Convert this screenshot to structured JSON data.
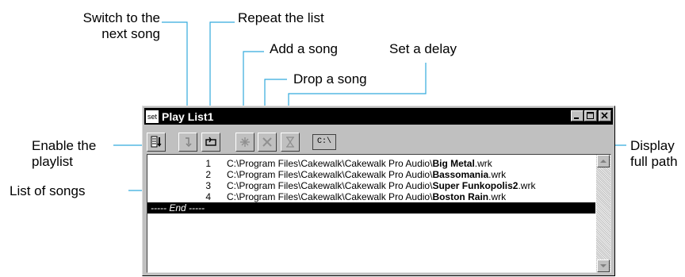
{
  "callouts": {
    "switch_next": "Switch to the\nnext song",
    "repeat": "Repeat the list",
    "add": "Add a song",
    "set_delay": "Set a delay",
    "drop": "Drop a song",
    "enable": "Enable the\nplaylist",
    "display_path": "Display\nfull path",
    "list_songs": "List of songs"
  },
  "window": {
    "icon_label": "set",
    "title": "Play List1",
    "path_button": "C:\\"
  },
  "songs": [
    {
      "num": "1",
      "dir": "C:\\Program Files\\Cakewalk\\Cakewalk Pro Audio\\",
      "name": "Big Metal",
      "ext": ".wrk"
    },
    {
      "num": "2",
      "dir": "C:\\Program Files\\Cakewalk\\Cakewalk Pro Audio\\",
      "name": "Bassomania",
      "ext": ".wrk"
    },
    {
      "num": "3",
      "dir": "C:\\Program Files\\Cakewalk\\Cakewalk Pro Audio\\",
      "name": "Super Funkopolis2",
      "ext": ".wrk"
    },
    {
      "num": "4",
      "dir": "C:\\Program Files\\Cakewalk\\Cakewalk Pro Audio\\",
      "name": "Boston Rain",
      "ext": ".wrk"
    }
  ],
  "end_label": "----- End -----",
  "colors": {
    "window_face": "#c0c0c0",
    "titlebar": "#000000",
    "selected_row": "#000000",
    "callout_line": "#33aadd"
  },
  "icons": {
    "enable": "playlist-enable-icon",
    "next": "next-song-icon",
    "repeat": "repeat-icon",
    "add": "add-song-icon",
    "drop": "drop-song-icon",
    "delay": "hourglass-icon"
  }
}
